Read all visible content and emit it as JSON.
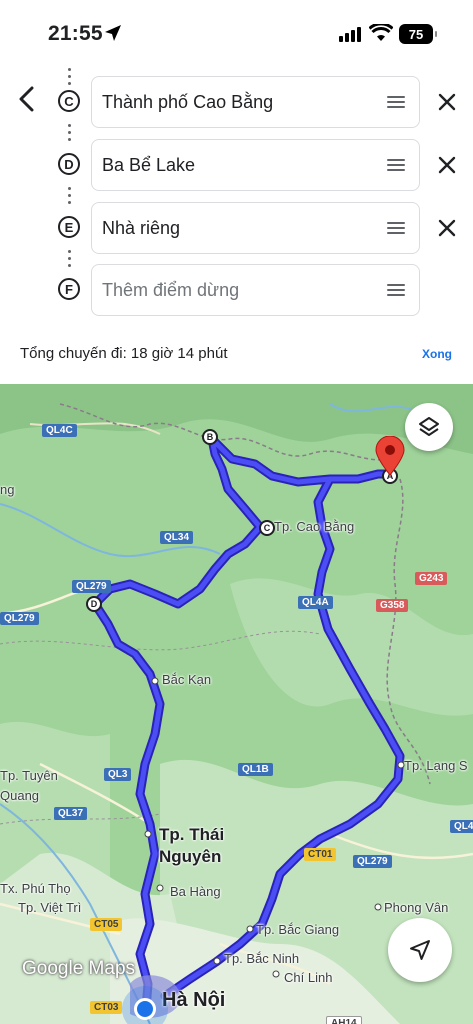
{
  "status_bar": {
    "time": "21:55",
    "battery": "75"
  },
  "directions": {
    "stops": [
      {
        "letter": "C",
        "value": "Thành phố Cao Bằng",
        "placeholder": ""
      },
      {
        "letter": "D",
        "value": "Ba Bể Lake",
        "placeholder": ""
      },
      {
        "letter": "E",
        "value": "Nhà riêng",
        "placeholder": ""
      },
      {
        "letter": "F",
        "value": "",
        "placeholder": "Thêm điểm dừng"
      }
    ],
    "total_trip": "Tổng chuyến đi: 18 giờ 14 phút",
    "done_label": "Xong"
  },
  "map": {
    "places": {
      "cao_bang": "Tp. Cao Bằng",
      "bac_kan": "Bắc Kạn",
      "tuyen_quang_1": "Tp. Tuyên",
      "tuyen_quang_2": "Quang",
      "thai_nguyen_1": "Tp. Thái",
      "thai_nguyen_2": "Nguyên",
      "ba_hang": "Ba Hàng",
      "phu_tho": "Tx. Phú Thọ",
      "viet_tri": "Tp. Việt Trì",
      "bac_giang": "Tp. Bắc Giang",
      "bac_ninh": "Tp. Bắc Ninh",
      "chi_linh": "Chí Linh",
      "phong_van": "Phong Vân",
      "lang_son": "Tp. Lạng S",
      "ha_noi": "Hà Nội",
      "edge_ng": "ng"
    },
    "roads": {
      "ql4c": "QL4C",
      "ql34": "QL34",
      "ql279_a": "QL279",
      "ql279_b": "QL279",
      "ql279_c": "QL279",
      "ql4a": "QL4A",
      "ql3": "QL3",
      "ql1b": "QL1B",
      "ql37": "QL37",
      "ct01": "CT01",
      "g243": "G243",
      "g358": "G358",
      "ct05": "CT05",
      "ct03": "CT03",
      "ql4_edge": "QL4",
      "ah14": "AH14"
    },
    "markers": {
      "a": "A",
      "b": "B",
      "c": "C",
      "d": "D"
    },
    "attribution": "Google Maps",
    "colors": {
      "route": "#3b3ff0",
      "route_outline": "#2a23b8",
      "land": "#9fd39a",
      "accent": "#1a73e8"
    }
  }
}
